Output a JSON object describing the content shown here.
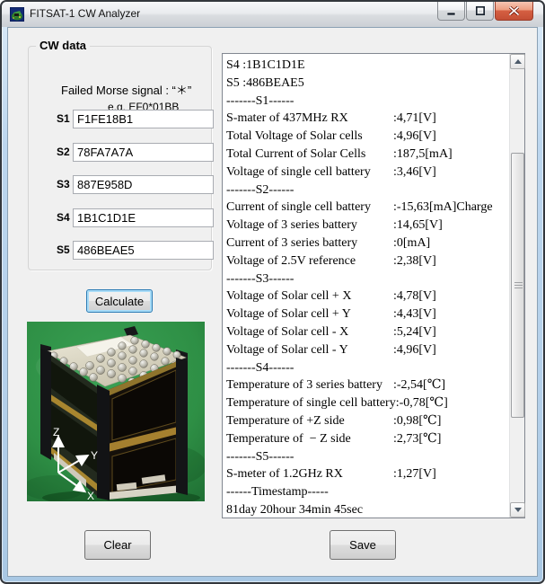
{
  "window": {
    "title": "FITSAT-1 CW Analyzer"
  },
  "icons": {
    "app": "satellite-app-icon",
    "minimize": "minimize-icon",
    "maximize": "maximize-icon",
    "close": "close-icon"
  },
  "cw_panel": {
    "group_title": "CW data",
    "hint_line1": "Failed Morse signal : “＊”",
    "hint_line2": "e.g. EF0*01BB",
    "fields": [
      {
        "label": "S1",
        "value": "F1FE18B1"
      },
      {
        "label": "S2",
        "value": "78FA7A7A"
      },
      {
        "label": "S3",
        "value": "887E958D"
      },
      {
        "label": "S4",
        "value": "1B1C1D1E"
      },
      {
        "label": "S5",
        "value": "486BEAE5"
      }
    ],
    "calculate_label": "Calculate"
  },
  "photo": {
    "axis_labels": {
      "x": "X",
      "y": "Y",
      "z": "Z"
    }
  },
  "output": {
    "lines": [
      {
        "label": "S4 :1B1C1D1E",
        "value": ""
      },
      {
        "label": "S5 :486BEAE5",
        "value": ""
      },
      {
        "label": "-------S1------",
        "value": ""
      },
      {
        "label": "S-mater of 437MHz RX",
        "value": ":4,71[V]"
      },
      {
        "label": "Total Voltage of Solar cells",
        "value": ":4,96[V]"
      },
      {
        "label": "Total Current of Solar Cells",
        "value": ":187,5[mA]"
      },
      {
        "label": "Voltage of single cell battery",
        "value": ":3,46[V]"
      },
      {
        "label": "-------S2------",
        "value": ""
      },
      {
        "label": "Current of single cell battery",
        "value": ":-15,63[mA]Charge"
      },
      {
        "label": "Voltage of 3 series battery",
        "value": ":14,65[V]"
      },
      {
        "label": "Current of 3 series battery",
        "value": ":0[mA]"
      },
      {
        "label": "Voltage of 2.5V reference",
        "value": ":2,38[V]"
      },
      {
        "label": "-------S3------",
        "value": ""
      },
      {
        "label": "Voltage of Solar cell + X",
        "value": ":4,78[V]"
      },
      {
        "label": "Voltage of Solar cell + Y",
        "value": ":4,43[V]"
      },
      {
        "label": "Voltage of Solar cell - X",
        "value": ":5,24[V]"
      },
      {
        "label": "Voltage of Solar cell - Y",
        "value": ":4,96[V]"
      },
      {
        "label": "-------S4------",
        "value": ""
      },
      {
        "label": "Temperature of 3 series battery",
        "value": ":-2,54[℃]"
      },
      {
        "label": "Temperature of single cell battery",
        "value": ":-0,78[℃]"
      },
      {
        "label": "Temperature of +Z side",
        "value": ":0,98[℃]"
      },
      {
        "label": "Temperature of  − Z side",
        "value": ":2,73[℃]"
      },
      {
        "label": "-------S5------",
        "value": ""
      },
      {
        "label": "S-meter of 1.2GHz RX",
        "value": ":1,27[V]"
      },
      {
        "label": "------Timestamp-----",
        "value": ""
      },
      {
        "label": "81day 20hour 34min 45sec",
        "value": ""
      }
    ]
  },
  "actions": {
    "clear_label": "Clear",
    "save_label": "Save"
  },
  "colors": {
    "frame_blue": "#b3cfe9",
    "client_bg": "#f0f0f0",
    "close_red": "#c44f35",
    "photo_green": "#2e8f45",
    "focus_ring": "#a8dcf7"
  }
}
